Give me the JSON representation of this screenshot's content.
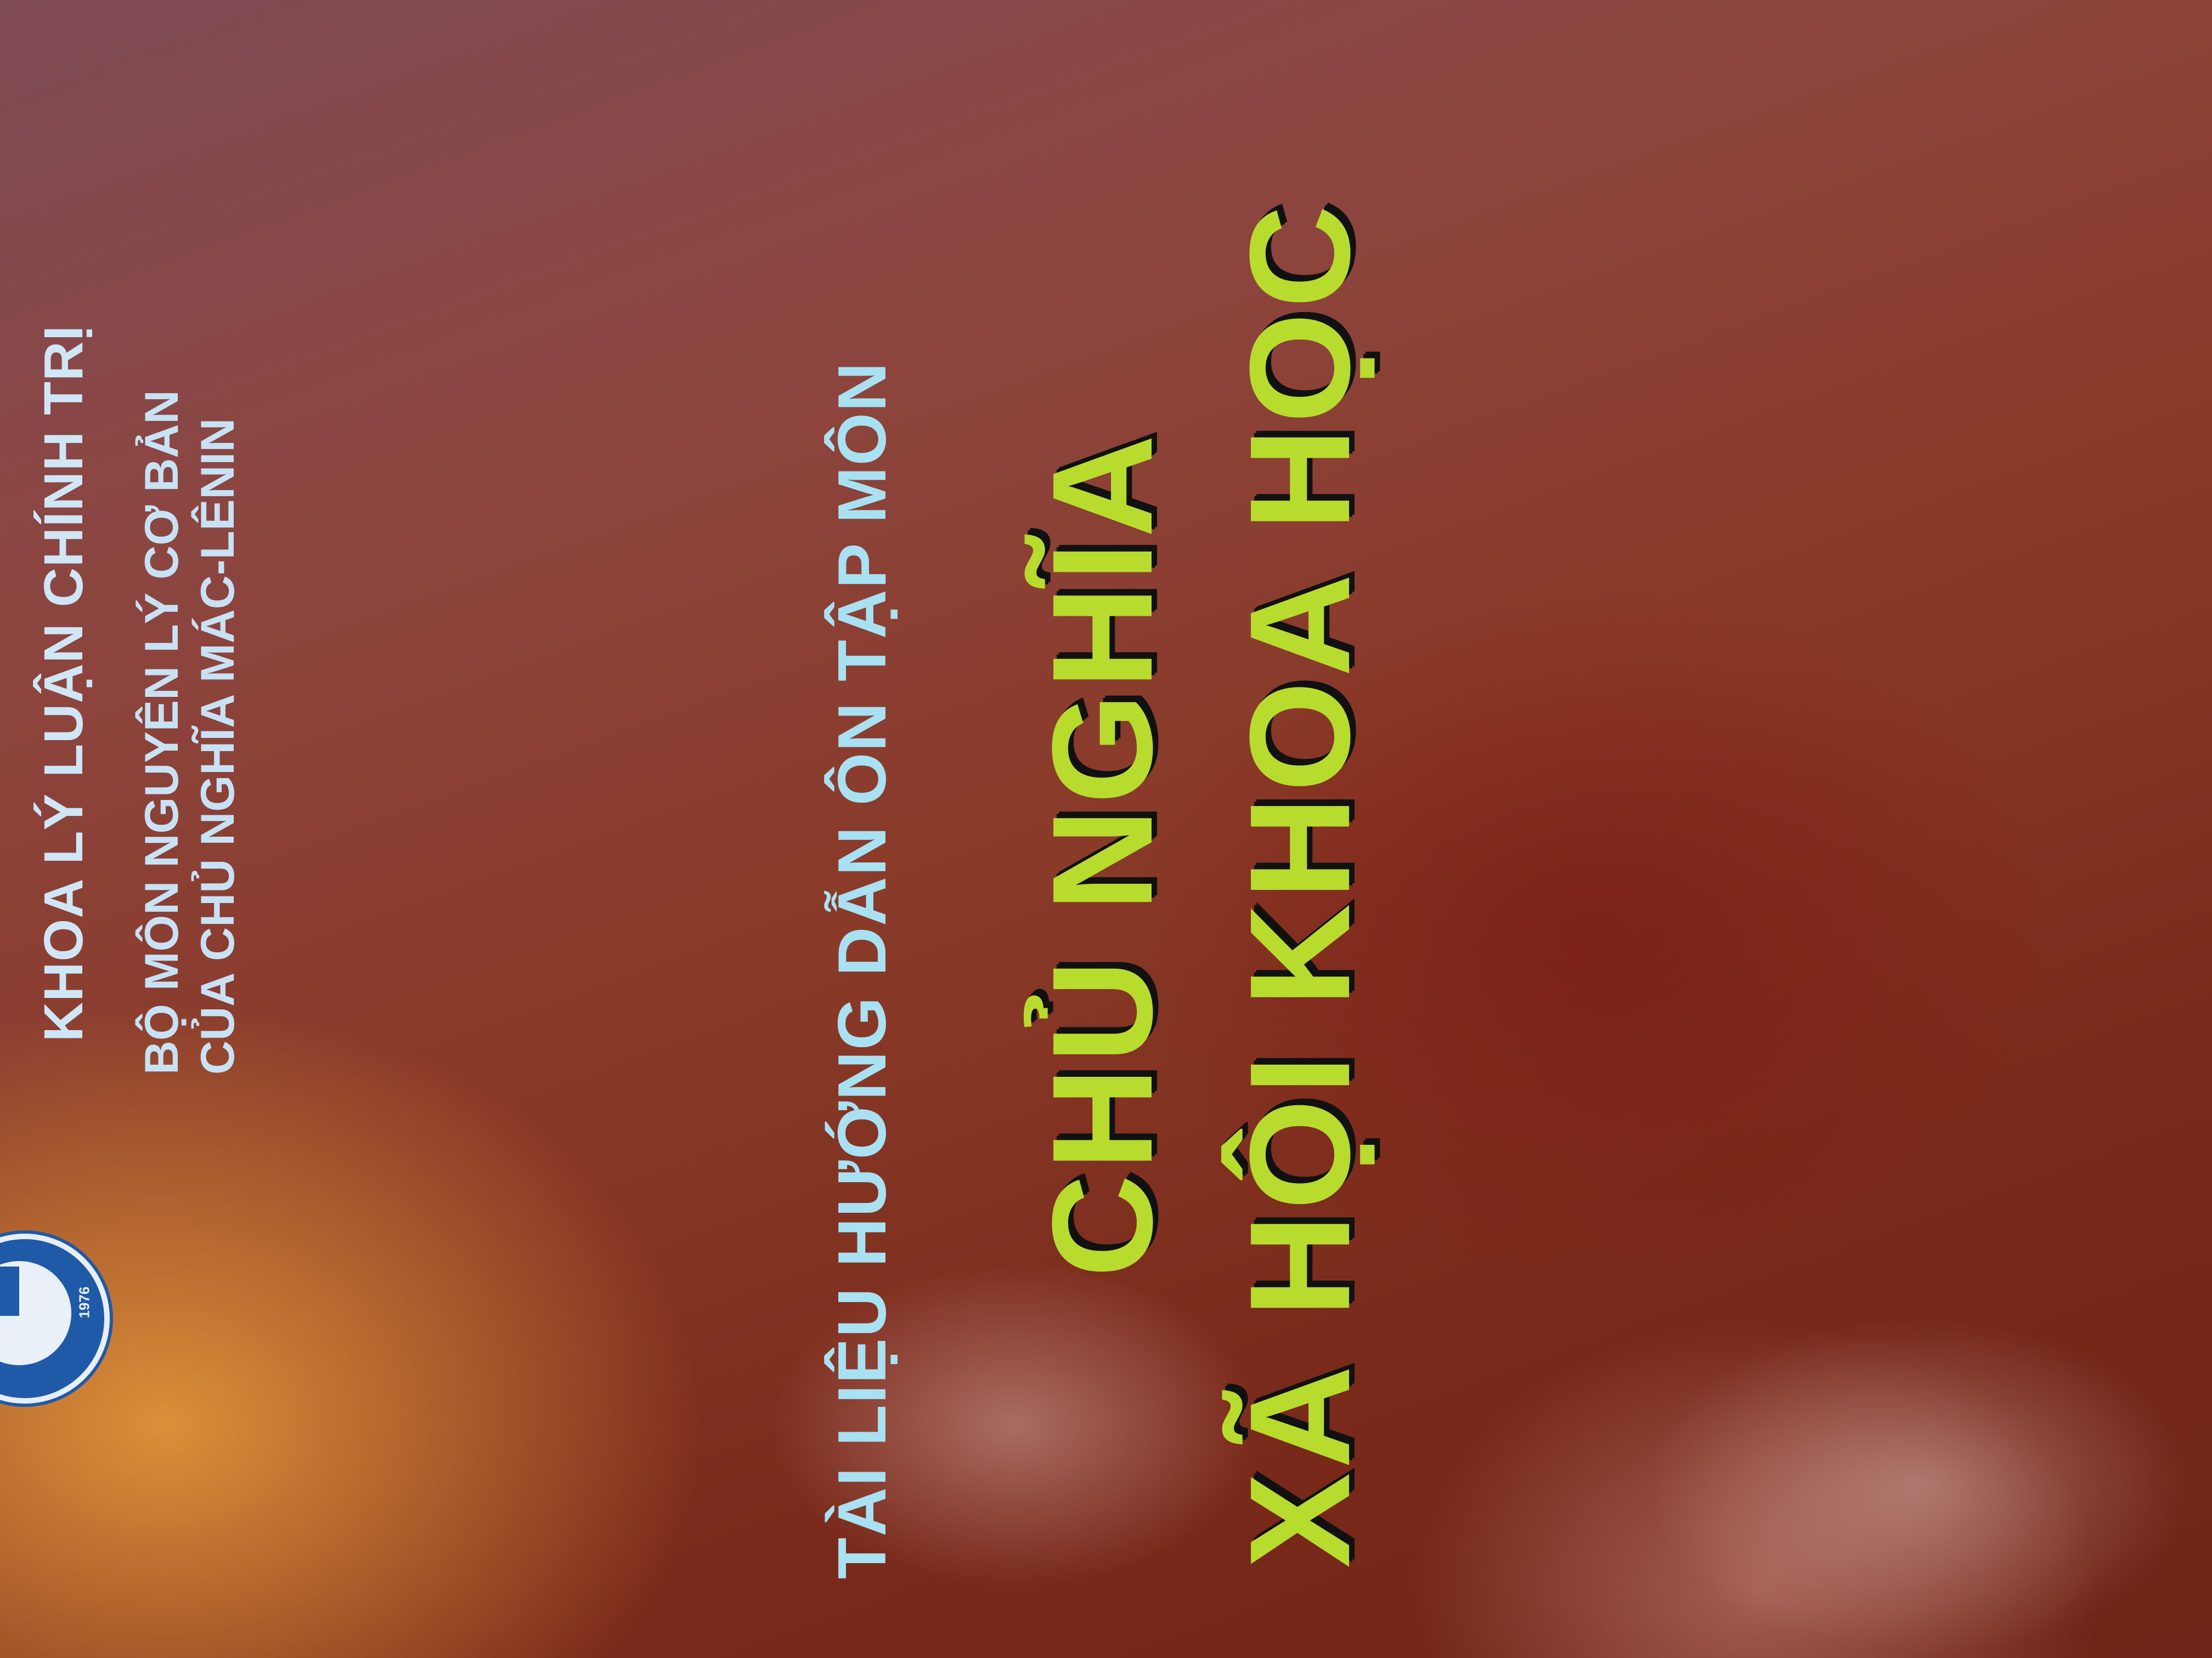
{
  "cover": {
    "institution_line": "KHOA LÝ LUẬN CHÍNH TRỊ",
    "department_line1": "BỘ MÔN NGUYÊN LÝ CƠ BẢN",
    "department_line2": "CỦA CHỦ NGHĨA MÁC-LÊNIN",
    "guide_line": "TÀI LIỆU HƯỚNG DẪN ÔN TẬP MÔN",
    "title_line1": "CHỦ NGHĨA",
    "title_line2": "XÃ HỘI KHOA HỌC",
    "emblem_year": "1976",
    "colors": {
      "background": "#8a3a28",
      "title": "#b8dc2e",
      "text": "#cfe6f6",
      "emblem": "#1f5aa8"
    }
  }
}
